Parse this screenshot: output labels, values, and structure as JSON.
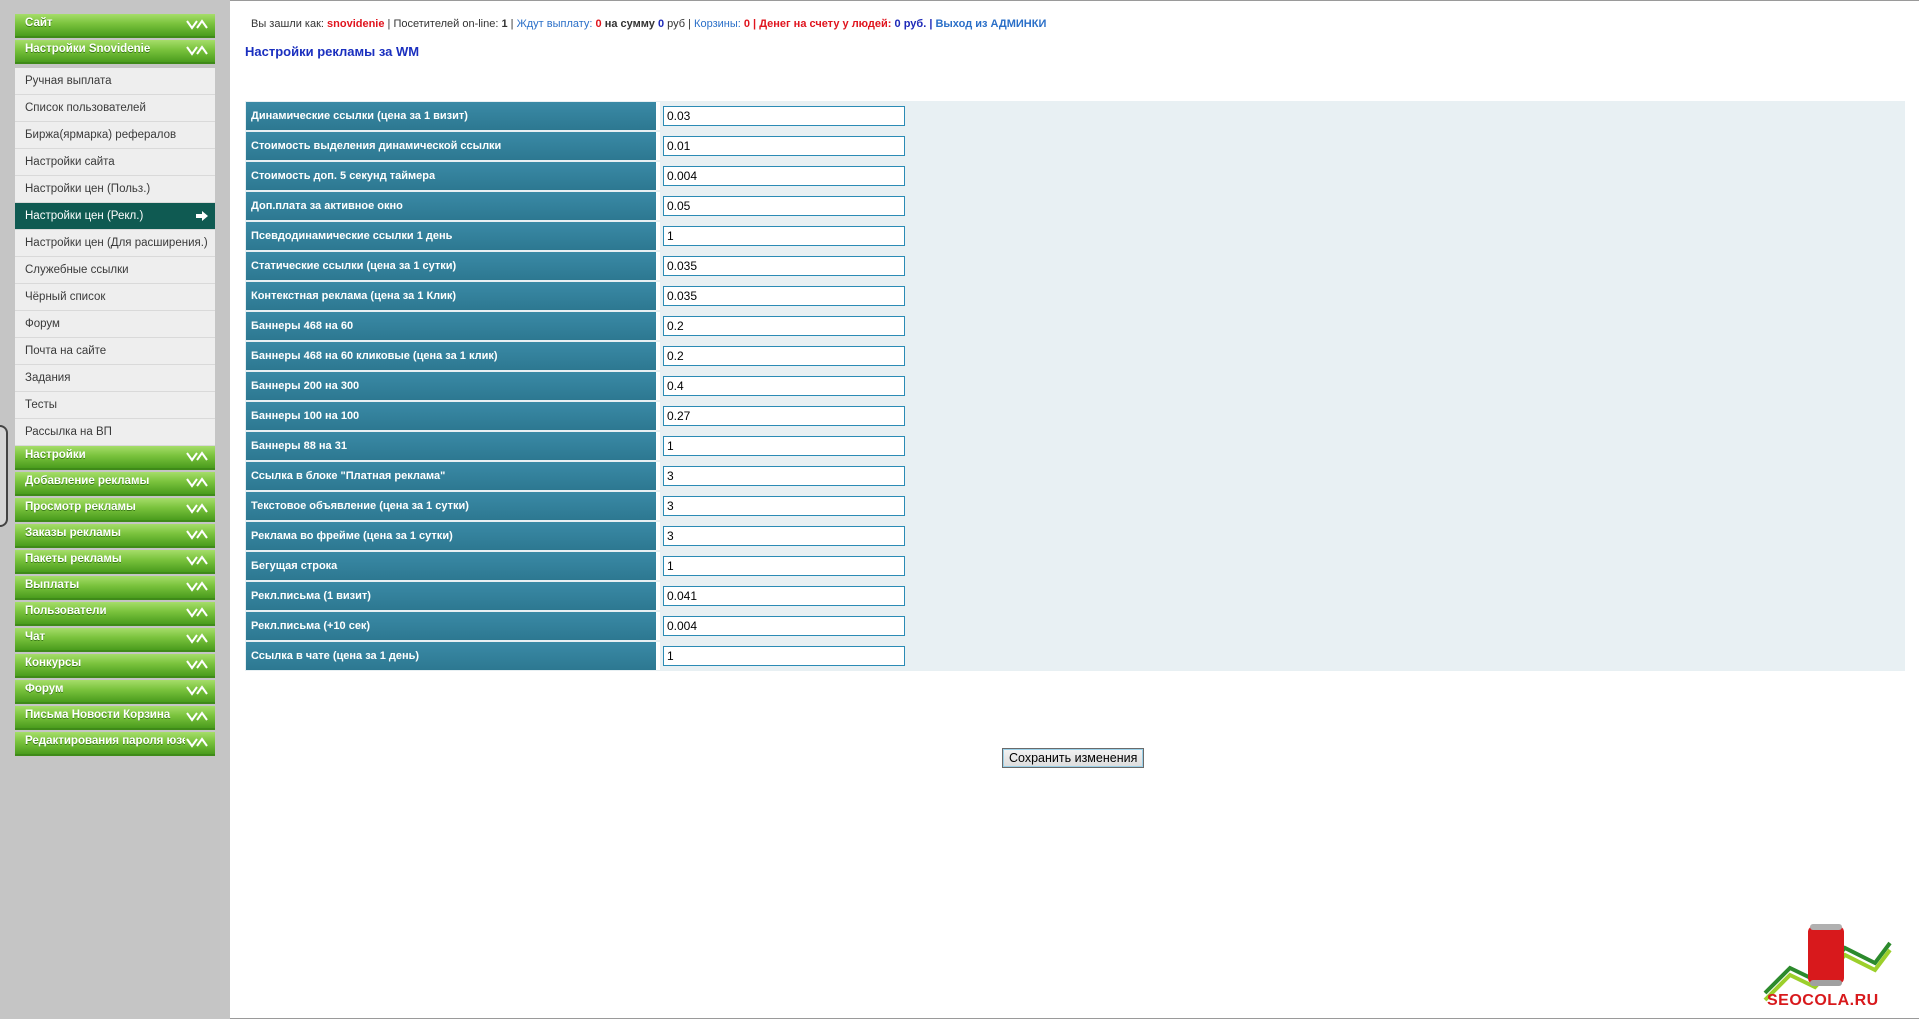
{
  "sidebar": {
    "site_label": "Сайт",
    "snov_label": "Настройки Snovidenie",
    "items": [
      {
        "label": "Ручная выплата"
      },
      {
        "label": "Список пользователей"
      },
      {
        "label": "Биржа(ярмарка) рефералов"
      },
      {
        "label": "Настройки сайта"
      },
      {
        "label": "Настройки цен (Польз.)"
      },
      {
        "label": "Настройки цен (Рекл.)"
      },
      {
        "label": "Настройки цен (Для расширения.)"
      },
      {
        "label": "Служебные ссылки"
      },
      {
        "label": "Чёрный список"
      },
      {
        "label": "Форум"
      },
      {
        "label": "Почта на сайте"
      },
      {
        "label": "Задания"
      },
      {
        "label": "Тесты"
      },
      {
        "label": "Рассылка на ВП"
      }
    ],
    "sections": [
      {
        "label": "Настройки"
      },
      {
        "label": "Добавление рекламы"
      },
      {
        "label": "Просмотр рекламы"
      },
      {
        "label": "Заказы рекламы"
      },
      {
        "label": "Пакеты рекламы"
      },
      {
        "label": "Выплаты"
      },
      {
        "label": "Пользователи"
      },
      {
        "label": "Чат"
      },
      {
        "label": "Конкурсы"
      },
      {
        "label": "Форум"
      },
      {
        "label": "Письма Новости Корзина"
      },
      {
        "label": "Редактирования пароля юзера"
      }
    ]
  },
  "infobar": {
    "logged_as": "Вы зашли как:",
    "username": "snovidenie",
    "sep1": "|",
    "visitors_label": "Посетителей on-line:",
    "visitors_count": "1",
    "sep2": "|",
    "awaiting_label": "Ждут выплату:",
    "awaiting_count": "0",
    "sum_label": "на сумму",
    "sum_value": "0",
    "currency": "руб",
    "sep3": "|",
    "carts_label": "Корзины:",
    "carts_count": "0",
    "sep4": "|",
    "money_label": "Денег на счету у людей:",
    "money_value": "0 руб.",
    "sep5": "|",
    "logout_label": "Выход из АДМИНКИ"
  },
  "page": {
    "title": "Настройки рекламы за WM",
    "save_label": "Сохранить изменения"
  },
  "settings": [
    {
      "label": "Динамические ссылки (цена за 1 визит)",
      "value": "0.03"
    },
    {
      "label": "Стоимость выделения динамической ссылки",
      "value": "0.01"
    },
    {
      "label": "Стоимость доп. 5 секунд таймера",
      "value": "0.004"
    },
    {
      "label": "Доп.плата за активное окно",
      "value": "0.05"
    },
    {
      "label": "Псевдодинамические ссылки 1 день",
      "value": "1"
    },
    {
      "label": "Статические ссылки (цена за 1 сутки)",
      "value": "0.035"
    },
    {
      "label": "Контекстная реклама (цена за 1 Клик)",
      "value": "0.035"
    },
    {
      "label": "Баннеры 468 на 60",
      "value": "0.2"
    },
    {
      "label": "Баннеры 468 на 60 кликовые (цена за 1 клик)",
      "value": "0.2"
    },
    {
      "label": "Баннеры 200 на 300",
      "value": "0.4"
    },
    {
      "label": "Баннеры 100 на 100",
      "value": "0.27"
    },
    {
      "label": "Баннеры 88 на 31",
      "value": "1"
    },
    {
      "label": "Ссылка в блоке \"Платная реклама\"",
      "value": "3"
    },
    {
      "label": "Текстовое объявление (цена за 1 сутки)",
      "value": "3"
    },
    {
      "label": "Реклама во фрейме (цена за 1 сутки)",
      "value": "3"
    },
    {
      "label": "Бегущая строка",
      "value": "1"
    },
    {
      "label": "Рекл.письма (1 визит)",
      "value": "0.041"
    },
    {
      "label": "Рекл.письма (+10 сек)",
      "value": "0.004"
    },
    {
      "label": "Ссылка в чате (цена за 1 день)",
      "value": "1"
    }
  ],
  "logo": {
    "text": "SEOCOLA.RU",
    "can_text": "SEO COLA"
  },
  "colors": {
    "sidebar_green": "#79c23c",
    "active_item": "#0f5a52",
    "label_cell": "#3a8aa6",
    "title_blue": "#1a2fbf",
    "accent_red": "#e0141e"
  }
}
